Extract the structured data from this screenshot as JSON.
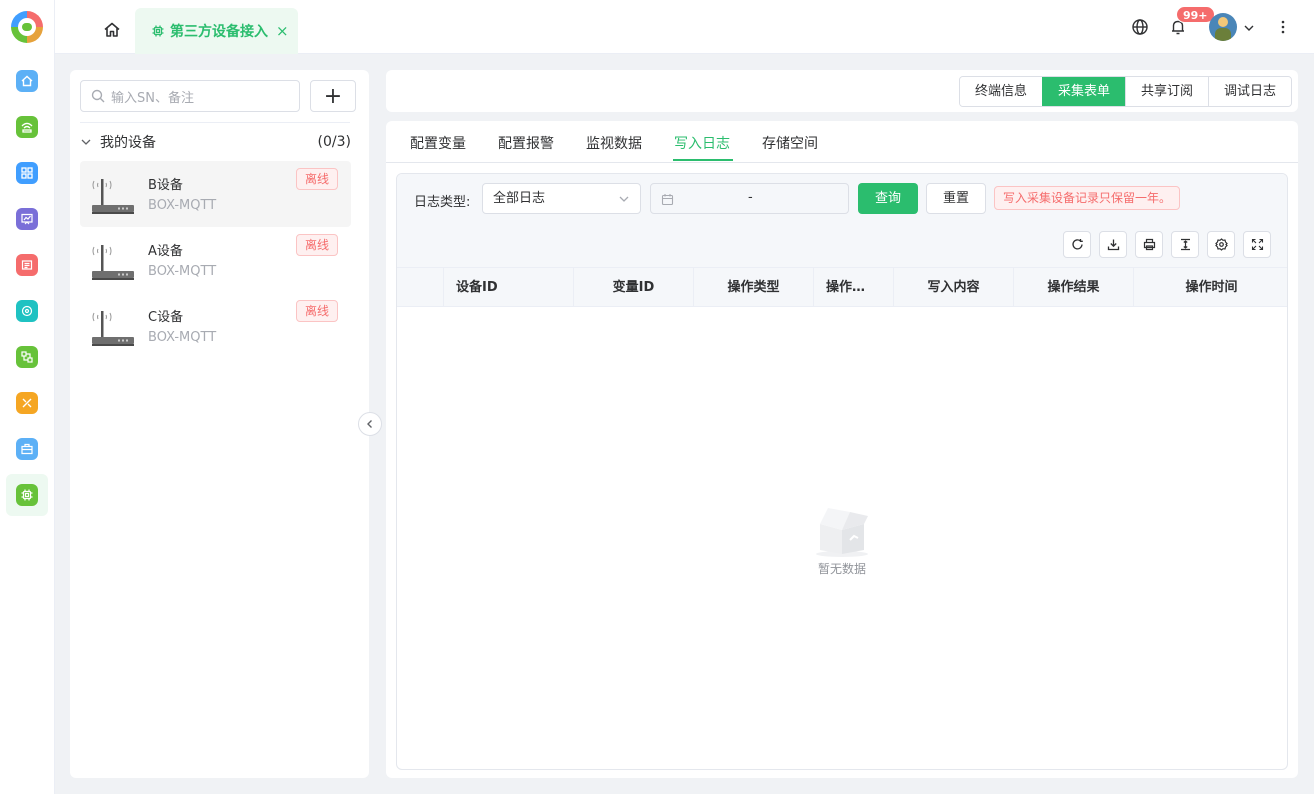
{
  "header": {
    "active_tab": "第三方设备接入",
    "notification_badge": "99+"
  },
  "left_panel": {
    "search_placeholder": "输入SN、备注",
    "add_label": "+",
    "group_title": "我的设备",
    "group_count": "(0/3)",
    "devices": [
      {
        "name": "B设备",
        "type": "BOX-MQTT",
        "status": "离线"
      },
      {
        "name": "A设备",
        "type": "BOX-MQTT",
        "status": "离线"
      },
      {
        "name": "C设备",
        "type": "BOX-MQTT",
        "status": "离线"
      }
    ]
  },
  "view_switch": {
    "options": [
      "终端信息",
      "采集表单",
      "共享订阅",
      "调试日志"
    ],
    "active": "采集表单"
  },
  "subtabs": {
    "items": [
      "配置变量",
      "配置报警",
      "监视数据",
      "写入日志",
      "存储空间"
    ],
    "active": "写入日志"
  },
  "filter": {
    "log_type_label": "日志类型:",
    "log_type_value": "全部日志",
    "date_separator": "-",
    "query_label": "查询",
    "reset_label": "重置",
    "notice": "写入采集设备记录只保留一年。"
  },
  "table": {
    "columns": [
      "设备ID",
      "变量ID",
      "操作类型",
      "操作…",
      "写入内容",
      "操作结果",
      "操作时间"
    ],
    "empty_text": "暂无数据"
  },
  "colors": {
    "accent": "#2bbd6e",
    "danger": "#f56c6c"
  }
}
